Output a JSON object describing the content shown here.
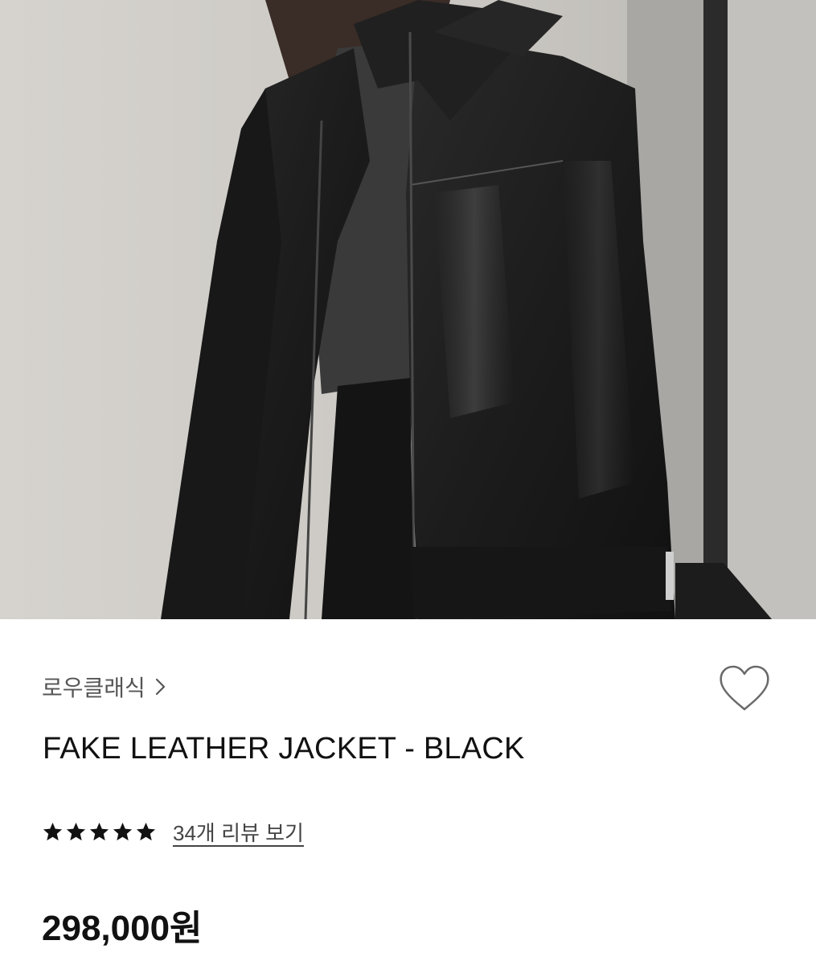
{
  "product": {
    "image_alt": "product photo",
    "brand": "로우클래식",
    "title": "FAKE LEATHER JACKET - BLACK",
    "rating": 5,
    "review_link": "34개 리뷰 보기",
    "price": "298,000원"
  },
  "icons": {
    "brand_chevron": "chevron-right-icon",
    "wishlist": "heart-outline-icon",
    "star": "star-filled-icon"
  },
  "colors": {
    "text_primary": "#111111",
    "text_secondary": "#555555",
    "star": "#111111"
  }
}
